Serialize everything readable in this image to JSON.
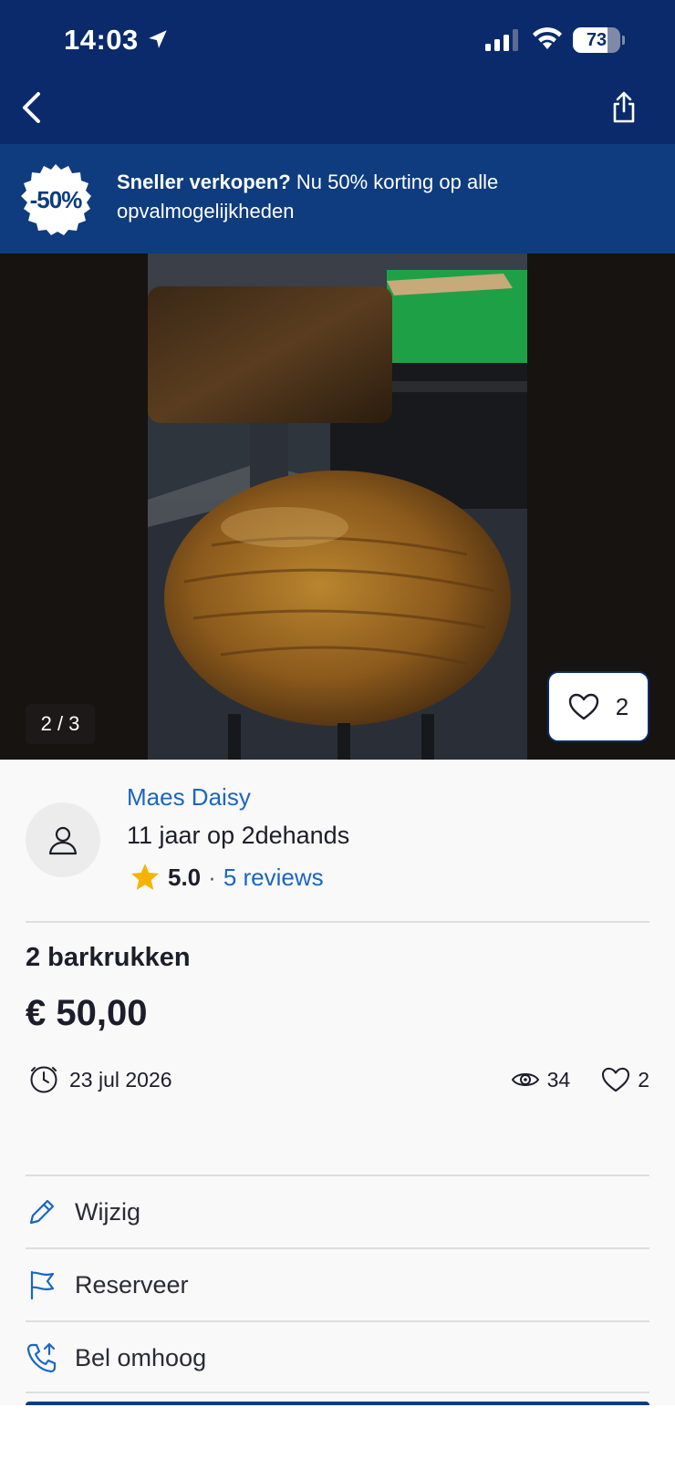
{
  "status_bar": {
    "time": "14:03",
    "battery": "73",
    "battery_level": 0.73
  },
  "nav": {
    "back_icon": "chevron-left-icon",
    "share_icon": "share-icon"
  },
  "promo": {
    "badge": "-50%",
    "bold": "Sneller verkopen?",
    "text": " Nu 50% korting op alle opvalmogelijkheden"
  },
  "gallery": {
    "counter": "2 / 3",
    "favorites": "2"
  },
  "seller": {
    "name": "Maes Daisy",
    "since": "11 jaar op 2dehands",
    "score": "5.0",
    "separator": "·",
    "reviews": "5 reviews"
  },
  "listing": {
    "title": "2 barkrukken",
    "price": "€ 50,00",
    "date": "23 jul 2026",
    "views": "34",
    "likes": "2"
  },
  "actions": [
    {
      "label": "Wijzig",
      "icon": "pencil-icon"
    },
    {
      "label": "Reserveer",
      "icon": "flag-icon"
    },
    {
      "label": "Bel omhoog",
      "icon": "phone-up-icon"
    }
  ],
  "colors": {
    "nav_bg": "#0a2a6b",
    "promo_bg": "#0e3c7e",
    "link": "#1a66c2",
    "icon_blue": "#1a66c2",
    "star": "#f5b400"
  }
}
